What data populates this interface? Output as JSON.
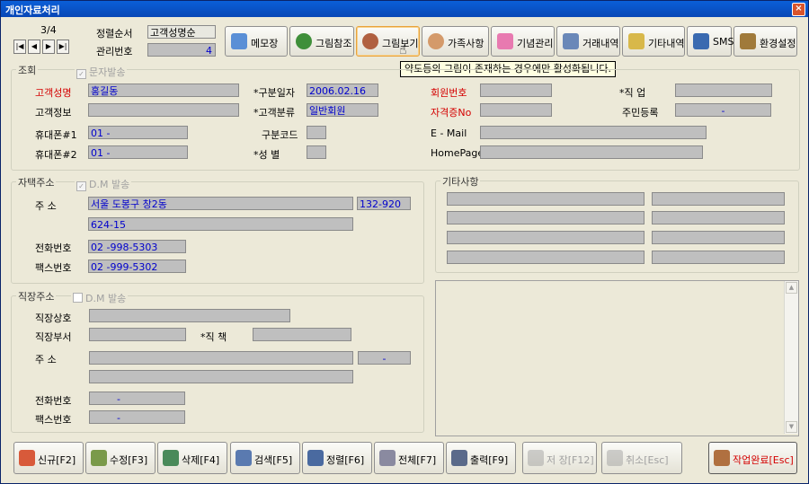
{
  "window": {
    "title": "개인자료처리",
    "close": "×"
  },
  "record": {
    "position": "3/4",
    "sort_label": "정렬순서",
    "sort_value": "고객성명순",
    "mgmt_label": "관리번호",
    "mgmt_value": "4"
  },
  "nav": {
    "first": "|◀",
    "prev": "◀",
    "next": "▶",
    "last": "▶|"
  },
  "toolbar": [
    {
      "label": "메모장",
      "icon": "notepad-icon"
    },
    {
      "label": "그림참조",
      "icon": "tree-icon"
    },
    {
      "label": "그림보기",
      "icon": "tree-view-icon"
    },
    {
      "label": "가족사항",
      "icon": "family-icon"
    },
    {
      "label": "기념관리",
      "icon": "cake-icon"
    },
    {
      "label": "거래내역",
      "icon": "transaction-icon"
    },
    {
      "label": "기타내역",
      "icon": "clipboard-icon"
    },
    {
      "label": "SMS",
      "icon": "phone-icon"
    },
    {
      "label": "환경설정",
      "icon": "settings-icon"
    }
  ],
  "tooltip": "약도등의 그림이 존재하는 경우에만 활성화됩니다.",
  "lookup": {
    "group": "조회",
    "sms_check": "문자발송",
    "name_label": "고객성명",
    "name": "홍길동",
    "info_label": "고객정보",
    "info": "",
    "mobile1_label": "휴대폰#1",
    "mobile1": "01 -",
    "mobile2_label": "휴대폰#2",
    "mobile2": "01 -",
    "date_label": "*구분일자",
    "date": "2006.02.16",
    "class_label": "*고객분류",
    "class": "일반회원",
    "code_label": "구분코드",
    "code": "",
    "gender_label": "*성    별",
    "gender": "",
    "member_label": "회원번호",
    "member": "",
    "license_label": "자격증No",
    "license": "",
    "email_label": "E - Mail",
    "email": "",
    "homepage_label": "HomePage",
    "homepage": "",
    "job_label": "*직    업",
    "job": "",
    "rrn_label": "주민등록",
    "rrn": "-"
  },
  "home": {
    "group": "자택주소",
    "dm_check": "D.M 발송",
    "addr_label": "주    소",
    "addr1": "서울 도봉구 창2동",
    "zip": "132-920",
    "addr2": "624-15",
    "phone_label": "전화번호",
    "phone": "02  -998-5303",
    "fax_label": "팩스번호",
    "fax": "02  -999-5302"
  },
  "work": {
    "group": "직장주소",
    "dm_check": "D.M 발송",
    "company_label": "직장상호",
    "company": "",
    "dept_label": "직장부서",
    "dept": "",
    "title_label": "*직    책",
    "title": "",
    "addr_label": "주    소",
    "addr1": "",
    "zip": "-",
    "addr2": "",
    "phone_label": "전화번호",
    "phone": "-",
    "fax_label": "팩스번호",
    "fax": "-"
  },
  "etc": {
    "group": "기타사항"
  },
  "bottom": [
    {
      "label": "신규[F2]",
      "icon": "new-user-icon",
      "enabled": true
    },
    {
      "label": "수정[F3]",
      "icon": "edit-user-icon",
      "enabled": true
    },
    {
      "label": "삭제[F4]",
      "icon": "delete-user-icon",
      "enabled": true
    },
    {
      "label": "검색[F5]",
      "icon": "search-user-icon",
      "enabled": true
    },
    {
      "label": "정렬[F6]",
      "icon": "sort-icon",
      "enabled": true
    },
    {
      "label": "전체[F7]",
      "icon": "list-icon",
      "enabled": true
    },
    {
      "label": "출력[F9]",
      "icon": "print-icon",
      "enabled": true
    },
    {
      "label": "저 장[F12]",
      "icon": "save-icon",
      "enabled": false
    },
    {
      "label": "취소[Esc]",
      "icon": "cancel-icon",
      "enabled": false
    },
    {
      "label": "작업완료[Esc]",
      "icon": "exit-door-icon",
      "enabled": true
    }
  ],
  "colors": {
    "accent": "#0a5fd8",
    "required": "#d40000",
    "value_text": "#0000cc",
    "field_bg": "#bfbfbf"
  }
}
